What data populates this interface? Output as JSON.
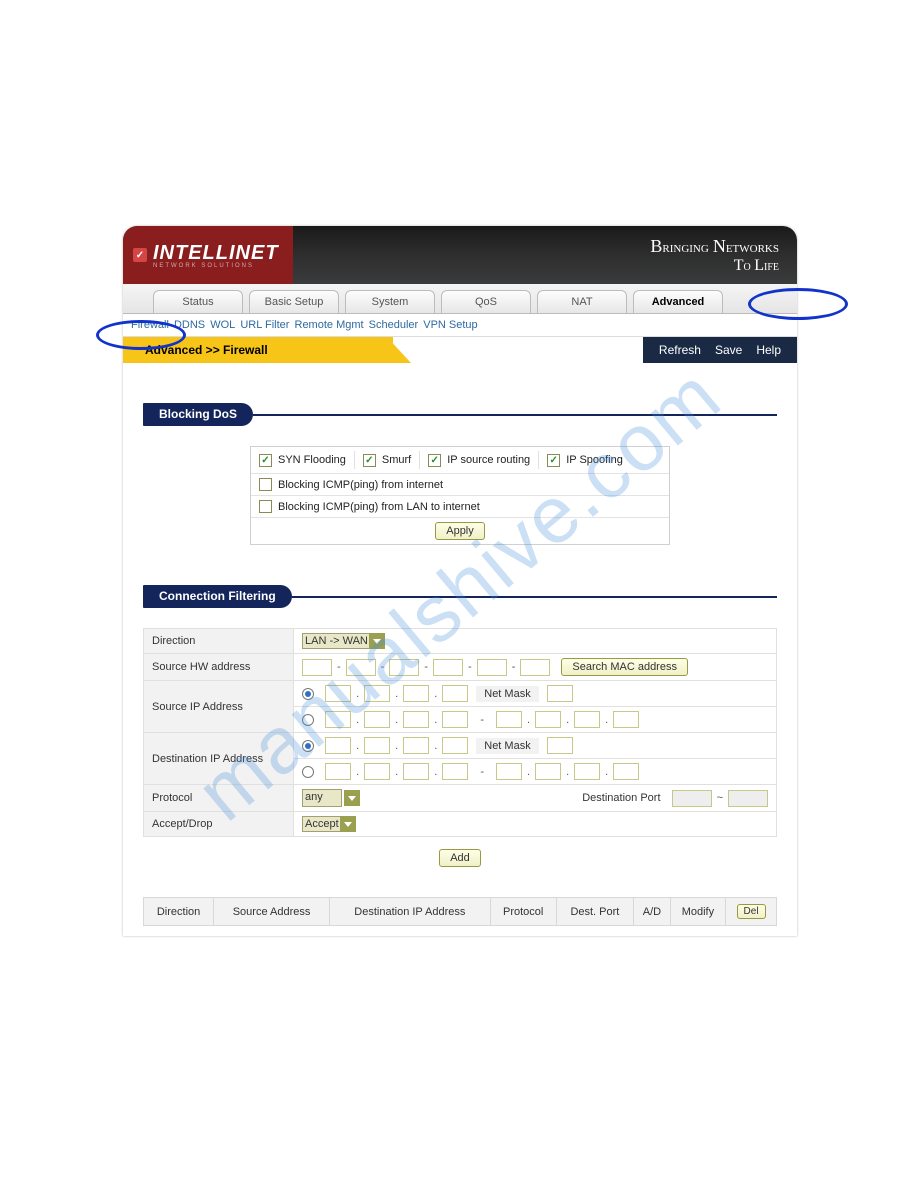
{
  "brand": {
    "name": "INTELLINET",
    "sub": "NETWORK SOLUTIONS"
  },
  "tagline": {
    "line1a": "B",
    "line1b": "ringing ",
    "line1c": "N",
    "line1d": "etworks",
    "line2a": "T",
    "line2b": "o ",
    "line2c": "L",
    "line2d": "ife"
  },
  "tabs": [
    "Status",
    "Basic Setup",
    "System",
    "QoS",
    "NAT",
    "Advanced"
  ],
  "active_tab_index": 5,
  "subnav": [
    "Firewall",
    "DDNS",
    "WOL",
    "URL Filter",
    "Remote Mgmt",
    "Scheduler",
    "VPN Setup"
  ],
  "breadcrumb": "Advanced >> Firewall",
  "actions": {
    "refresh": "Refresh",
    "save": "Save",
    "help": "Help"
  },
  "sections": {
    "dos": "Blocking DoS",
    "conn": "Connection Filtering"
  },
  "dos": {
    "syn": {
      "label": "SYN Flooding",
      "checked": true
    },
    "smurf": {
      "label": "Smurf",
      "checked": true
    },
    "ipsrc": {
      "label": "IP source routing",
      "checked": true
    },
    "ipspoof": {
      "label": "IP Spoofing",
      "checked": true
    },
    "icmp_inet": {
      "label": "Blocking ICMP(ping) from internet",
      "checked": false
    },
    "icmp_lan": {
      "label": "Blocking ICMP(ping) from LAN to internet",
      "checked": false
    },
    "apply": "Apply"
  },
  "form": {
    "direction_label": "Direction",
    "direction_value": "LAN -> WAN",
    "src_hw_label": "Source HW address",
    "search_mac": "Search MAC address",
    "src_ip_label": "Source IP Address",
    "dst_ip_label": "Destination IP Address",
    "netmask": "Net Mask",
    "protocol_label": "Protocol",
    "protocol_value": "any",
    "dest_port_label": "Destination Port",
    "port_sep": "~",
    "accept_label": "Accept/Drop",
    "accept_value": "Accept",
    "add": "Add",
    "dash": "-",
    "dot": "."
  },
  "table_headers": [
    "Direction",
    "Source Address",
    "Destination IP Address",
    "Protocol",
    "Dest. Port",
    "A/D",
    "Modify",
    "Del"
  ],
  "del_btn": "Del",
  "watermark": "manualshive.com"
}
